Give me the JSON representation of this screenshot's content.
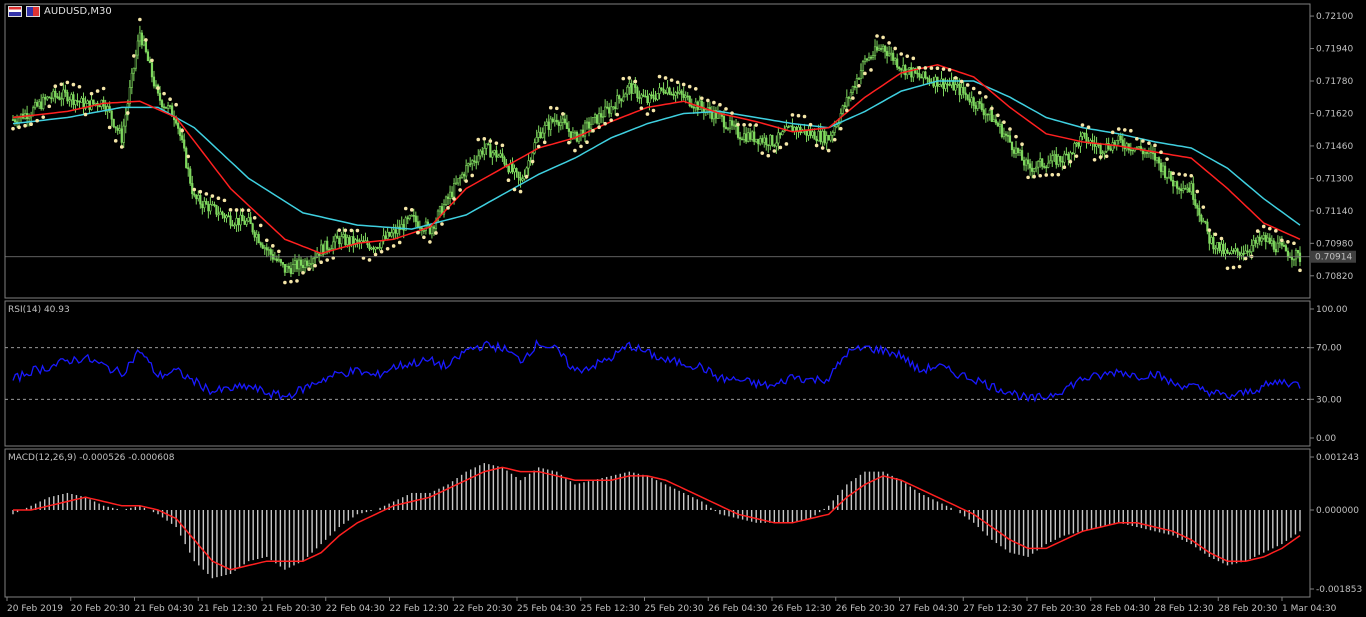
{
  "symbol_label": "AUDUSD,M30",
  "colors": {
    "background": "#000000",
    "panel_border": "#808080",
    "bull_candle": "#7fd85f",
    "bear_candle": "#7fd85f",
    "ma_fast": "#ff2020",
    "ma_slow": "#3fd0e0",
    "sar": "#f5e6a8",
    "rsi": "#1a1aff",
    "macd_hist": "#c8c8c8",
    "macd_signal": "#ff2020",
    "current_price_line": "#808080",
    "current_price_box": "#404040"
  },
  "chart_data": [
    {
      "type": "candlestick",
      "panel": "price",
      "title": "AUDUSD,M30",
      "indicators": [
        "moving-average-fast (red)",
        "moving-average-slow (cyan)",
        "parabolic-sar (dots)"
      ],
      "y_ticks": [
        "0.72100",
        "0.71940",
        "0.71780",
        "0.71620",
        "0.71460",
        "0.71300",
        "0.71140",
        "0.70980",
        "0.70820"
      ],
      "ylim": [
        0.7075,
        0.7212
      ],
      "current_price": "0.70914",
      "close_path": [
        [
          0,
          0.7159
        ],
        [
          1,
          0.7163
        ],
        [
          2,
          0.717
        ],
        [
          3,
          0.7171
        ],
        [
          4,
          0.7166
        ],
        [
          5,
          0.7168
        ],
        [
          6,
          0.715
        ],
        [
          7,
          0.7202
        ],
        [
          8,
          0.717
        ],
        [
          9,
          0.716
        ],
        [
          10,
          0.712
        ],
        [
          11,
          0.7115
        ],
        [
          12,
          0.711
        ],
        [
          13,
          0.7108
        ],
        [
          14,
          0.7095
        ],
        [
          15,
          0.7085
        ],
        [
          16,
          0.7088
        ],
        [
          17,
          0.7095
        ],
        [
          18,
          0.71
        ],
        [
          19,
          0.7098
        ],
        [
          20,
          0.7097
        ],
        [
          21,
          0.7103
        ],
        [
          22,
          0.711
        ],
        [
          23,
          0.7105
        ],
        [
          24,
          0.712
        ],
        [
          25,
          0.7135
        ],
        [
          26,
          0.7145
        ],
        [
          27,
          0.714
        ],
        [
          28,
          0.7128
        ],
        [
          29,
          0.7152
        ],
        [
          30,
          0.716
        ],
        [
          31,
          0.715
        ],
        [
          32,
          0.7158
        ],
        [
          33,
          0.7165
        ],
        [
          34,
          0.7175
        ],
        [
          35,
          0.7168
        ],
        [
          36,
          0.7175
        ],
        [
          37,
          0.717
        ],
        [
          38,
          0.7165
        ],
        [
          39,
          0.716
        ],
        [
          40,
          0.7152
        ],
        [
          41,
          0.715
        ],
        [
          42,
          0.7148
        ],
        [
          43,
          0.7155
        ],
        [
          44,
          0.7152
        ],
        [
          45,
          0.715
        ],
        [
          46,
          0.7168
        ],
        [
          47,
          0.7188
        ],
        [
          48,
          0.7195
        ],
        [
          49,
          0.7185
        ],
        [
          50,
          0.718
        ],
        [
          51,
          0.7178
        ],
        [
          52,
          0.7175
        ],
        [
          53,
          0.7168
        ],
        [
          54,
          0.716
        ],
        [
          55,
          0.7148
        ],
        [
          56,
          0.7135
        ],
        [
          57,
          0.7138
        ],
        [
          58,
          0.714
        ],
        [
          59,
          0.715
        ],
        [
          60,
          0.7145
        ],
        [
          61,
          0.7148
        ],
        [
          62,
          0.7145
        ],
        [
          63,
          0.714
        ],
        [
          64,
          0.7128
        ],
        [
          65,
          0.7125
        ],
        [
          66,
          0.71
        ],
        [
          67,
          0.7092
        ],
        [
          68,
          0.7095
        ],
        [
          69,
          0.71
        ],
        [
          70,
          0.7095
        ],
        [
          71,
          0.7091
        ]
      ],
      "ma_fast_path": [
        [
          0,
          0.716
        ],
        [
          3,
          0.7163
        ],
        [
          5,
          0.7167
        ],
        [
          7,
          0.7168
        ],
        [
          9,
          0.716
        ],
        [
          12,
          0.7125
        ],
        [
          15,
          0.71
        ],
        [
          17,
          0.7093
        ],
        [
          19,
          0.7098
        ],
        [
          21,
          0.71
        ],
        [
          23,
          0.7106
        ],
        [
          25,
          0.7125
        ],
        [
          27,
          0.7135
        ],
        [
          29,
          0.7145
        ],
        [
          31,
          0.715
        ],
        [
          33,
          0.7158
        ],
        [
          35,
          0.7165
        ],
        [
          37,
          0.7168
        ],
        [
          39,
          0.7162
        ],
        [
          41,
          0.7158
        ],
        [
          43,
          0.7153
        ],
        [
          45,
          0.7155
        ],
        [
          47,
          0.717
        ],
        [
          49,
          0.7182
        ],
        [
          51,
          0.7186
        ],
        [
          53,
          0.718
        ],
        [
          55,
          0.7165
        ],
        [
          57,
          0.7152
        ],
        [
          59,
          0.7148
        ],
        [
          61,
          0.7146
        ],
        [
          63,
          0.7143
        ],
        [
          65,
          0.714
        ],
        [
          67,
          0.7125
        ],
        [
          69,
          0.7108
        ],
        [
          71,
          0.71
        ]
      ],
      "ma_slow_path": [
        [
          0,
          0.7157
        ],
        [
          3,
          0.716
        ],
        [
          6,
          0.7165
        ],
        [
          8,
          0.7165
        ],
        [
          10,
          0.7155
        ],
        [
          13,
          0.713
        ],
        [
          16,
          0.7113
        ],
        [
          19,
          0.7107
        ],
        [
          22,
          0.7105
        ],
        [
          25,
          0.7112
        ],
        [
          27,
          0.7122
        ],
        [
          29,
          0.7132
        ],
        [
          31,
          0.714
        ],
        [
          33,
          0.715
        ],
        [
          35,
          0.7157
        ],
        [
          37,
          0.7162
        ],
        [
          39,
          0.7163
        ],
        [
          41,
          0.716
        ],
        [
          43,
          0.7157
        ],
        [
          45,
          0.7155
        ],
        [
          47,
          0.7163
        ],
        [
          49,
          0.7173
        ],
        [
          51,
          0.7178
        ],
        [
          53,
          0.7178
        ],
        [
          55,
          0.717
        ],
        [
          57,
          0.716
        ],
        [
          59,
          0.7155
        ],
        [
          61,
          0.7152
        ],
        [
          63,
          0.7148
        ],
        [
          65,
          0.7145
        ],
        [
          67,
          0.7135
        ],
        [
          69,
          0.712
        ],
        [
          71,
          0.7107
        ]
      ]
    },
    {
      "type": "line",
      "panel": "rsi",
      "title": "RSI(14) 40.93",
      "y_ticks": [
        "100.00",
        "70.00",
        "30.00",
        "0.00"
      ],
      "levels": [
        70,
        30
      ],
      "ylim": [
        0,
        100
      ],
      "series": [
        {
          "values": [
            45,
            52,
            55,
            60,
            62,
            56,
            50,
            68,
            48,
            52,
            44,
            36,
            38,
            40,
            35,
            32,
            38,
            45,
            50,
            52,
            48,
            55,
            58,
            60,
            55,
            68,
            72,
            70,
            60,
            74,
            68,
            52,
            56,
            62,
            72,
            66,
            60,
            58,
            55,
            46,
            45,
            42,
            40,
            48,
            45,
            46,
            66,
            70,
            68,
            64,
            52,
            56,
            50,
            46,
            40,
            36,
            30,
            32,
            38,
            46,
            48,
            52,
            48,
            50,
            42,
            40,
            36,
            32,
            35,
            40,
            44,
            41
          ]
        }
      ]
    },
    {
      "type": "bar+line",
      "panel": "macd",
      "title": "MACD(12,26,9) -0.000526 -0.000608",
      "y_ticks": [
        "0.001243",
        "0.000000",
        "-0.001853"
      ],
      "ylim": [
        -0.001853,
        0.001243
      ],
      "series": [
        {
          "type": "bar",
          "values": [
            -0.0001,
            0.0001,
            0.0003,
            0.0004,
            0.0003,
            0.0001,
            0.0,
            0.0001,
            -0.0001,
            -0.0004,
            -0.0012,
            -0.0016,
            -0.0015,
            -0.0012,
            -0.0011,
            -0.0014,
            -0.0012,
            -0.0008,
            -0.0004,
            -0.0001,
            0.0,
            0.0002,
            0.0004,
            0.0004,
            0.0006,
            0.0009,
            0.0011,
            0.001,
            0.0007,
            0.001,
            0.0009,
            0.0006,
            0.0007,
            0.0008,
            0.0009,
            0.0008,
            0.0006,
            0.0004,
            0.0002,
            -0.0001,
            -0.0002,
            -0.0003,
            -0.0003,
            -0.0003,
            -0.0002,
            0.0001,
            0.0006,
            0.0009,
            0.0009,
            0.0007,
            0.0004,
            0.0002,
            0.0,
            -0.0003,
            -0.0007,
            -0.001,
            -0.0011,
            -0.0008,
            -0.0006,
            -0.0005,
            -0.0004,
            -0.0003,
            -0.0004,
            -0.0005,
            -0.0006,
            -0.0008,
            -0.0011,
            -0.0013,
            -0.0012,
            -0.001,
            -0.0008,
            -0.0005
          ]
        },
        {
          "type": "line",
          "values": [
            0.0,
            0.0,
            0.0001,
            0.0002,
            0.0003,
            0.0002,
            0.0001,
            0.0001,
            0.0,
            -0.0002,
            -0.0007,
            -0.0012,
            -0.0014,
            -0.0013,
            -0.0012,
            -0.0012,
            -0.0012,
            -0.001,
            -0.0006,
            -0.0003,
            -0.0001,
            0.0001,
            0.0002,
            0.0003,
            0.0005,
            0.0007,
            0.0009,
            0.001,
            0.0009,
            0.0009,
            0.0008,
            0.0007,
            0.0007,
            0.0007,
            0.0008,
            0.0008,
            0.0007,
            0.0005,
            0.0003,
            0.0001,
            -0.0001,
            -0.0002,
            -0.0003,
            -0.0003,
            -0.0002,
            -0.0001,
            0.0003,
            0.0006,
            0.0008,
            0.0007,
            0.0005,
            0.0003,
            0.0001,
            -0.0001,
            -0.0004,
            -0.0007,
            -0.0009,
            -0.0009,
            -0.0007,
            -0.0005,
            -0.0004,
            -0.0003,
            -0.0003,
            -0.0004,
            -0.0005,
            -0.0007,
            -0.001,
            -0.0012,
            -0.0012,
            -0.0011,
            -0.0009,
            -0.0006
          ]
        }
      ]
    }
  ],
  "x_ticks": [
    "20 Feb 2019",
    "20 Feb 20:30",
    "21 Feb 04:30",
    "21 Feb 12:30",
    "21 Feb 20:30",
    "22 Feb 04:30",
    "22 Feb 12:30",
    "22 Feb 20:30",
    "25 Feb 04:30",
    "25 Feb 12:30",
    "25 Feb 20:30",
    "26 Feb 04:30",
    "26 Feb 12:30",
    "26 Feb 20:30",
    "27 Feb 04:30",
    "27 Feb 12:30",
    "27 Feb 20:30",
    "28 Feb 04:30",
    "28 Feb 12:30",
    "28 Feb 20:30",
    "1 Mar 04:30"
  ]
}
